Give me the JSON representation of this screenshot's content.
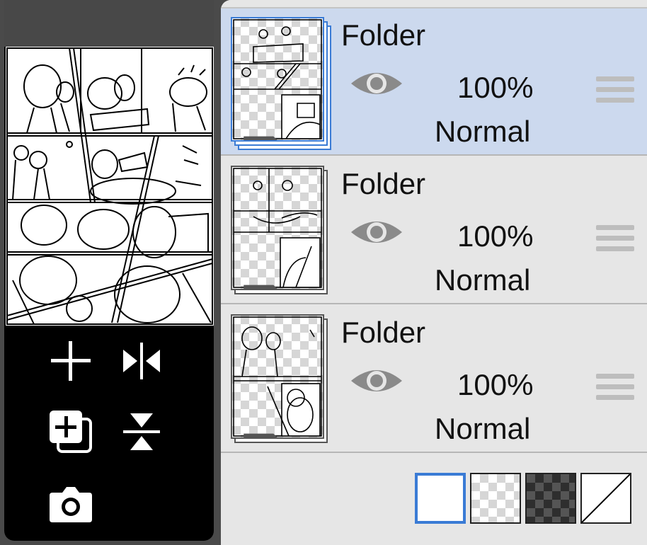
{
  "layers": [
    {
      "name": "Folder",
      "opacity": "100%",
      "blend_mode": "Normal",
      "visible": true,
      "selected": true
    },
    {
      "name": "Folder",
      "opacity": "100%",
      "blend_mode": "Normal",
      "visible": true,
      "selected": false
    },
    {
      "name": "Folder",
      "opacity": "100%",
      "blend_mode": "Normal",
      "visible": true,
      "selected": false
    }
  ],
  "tools": [
    {
      "icon": "plus-icon"
    },
    {
      "icon": "flip-horizontal-icon"
    },
    {
      "icon": "add-layer-icon"
    },
    {
      "icon": "flip-vertical-icon"
    },
    {
      "icon": "camera-icon"
    }
  ],
  "background_options": [
    {
      "icon": "white-background",
      "selected": true
    },
    {
      "icon": "light-checker-background",
      "selected": false
    },
    {
      "icon": "dark-checker-background",
      "selected": false
    },
    {
      "icon": "no-background",
      "selected": false
    }
  ],
  "colors": {
    "accent": "#3a7bd5",
    "selected_row": "#ccd9ee",
    "panel": "#e6e6e6",
    "eye": "#8a8a8a"
  }
}
